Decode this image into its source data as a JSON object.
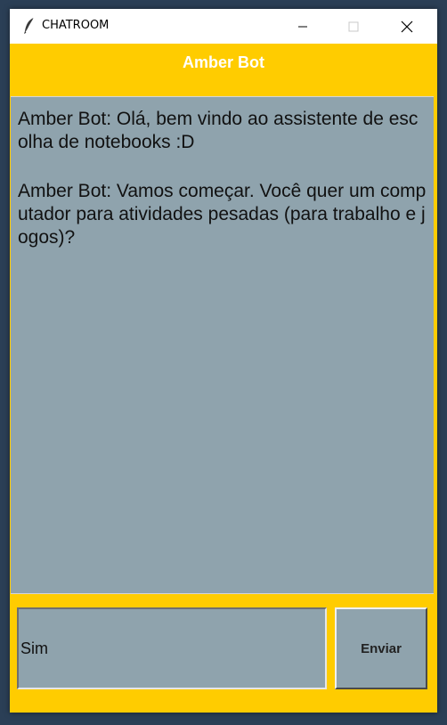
{
  "window": {
    "title": "CHATROOM",
    "icons": [
      "feather-icon",
      "minimize-icon",
      "maximize-icon",
      "close-icon"
    ]
  },
  "header": {
    "title": "Amber Bot"
  },
  "chat": {
    "messages": [
      "Amber Bot: Olá, bem vindo ao assistente de escolha de notebooks :D",
      "Amber Bot: Vamos começar. Você quer um computador para atividades pesadas (para trabalho e jogos)?"
    ]
  },
  "input": {
    "value": "Sim"
  },
  "send": {
    "label": "Enviar"
  },
  "colors": {
    "accent": "#ffcc00",
    "chat_bg": "#8fa3ad",
    "desktop": "#2b3f56"
  }
}
